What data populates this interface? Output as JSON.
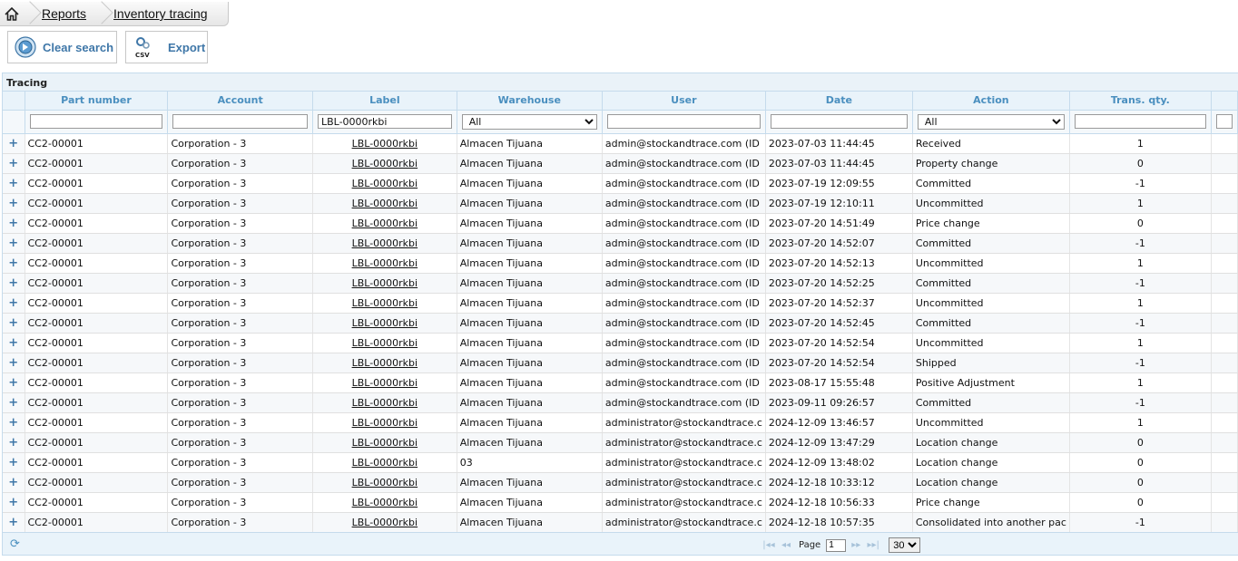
{
  "breadcrumb": {
    "items": [
      "Reports",
      "Inventory tracing"
    ]
  },
  "toolbar": {
    "clear_label": "Clear search",
    "export_label": "Export",
    "csv_text": "CSV"
  },
  "grid": {
    "caption": "Tracing",
    "columns": [
      "Part number",
      "Account",
      "Label",
      "Warehouse",
      "User",
      "Date",
      "Action",
      "Trans. qty."
    ],
    "filters": {
      "part": "",
      "account": "",
      "label": "LBL-0000rkbi",
      "warehouse": "All",
      "user": "",
      "date": "",
      "action": "All",
      "qty": ""
    },
    "rows": [
      [
        "CC2-00001",
        "Corporation - 3",
        "LBL-0000rkbi",
        "Almacen Tijuana",
        "admin@stockandtrace.com (ID",
        "2023-07-03 11:44:45",
        "Received",
        "1"
      ],
      [
        "CC2-00001",
        "Corporation - 3",
        "LBL-0000rkbi",
        "Almacen Tijuana",
        "admin@stockandtrace.com (ID",
        "2023-07-03 11:44:45",
        "Property change",
        "0"
      ],
      [
        "CC2-00001",
        "Corporation - 3",
        "LBL-0000rkbi",
        "Almacen Tijuana",
        "admin@stockandtrace.com (ID",
        "2023-07-19 12:09:55",
        "Committed",
        "-1"
      ],
      [
        "CC2-00001",
        "Corporation - 3",
        "LBL-0000rkbi",
        "Almacen Tijuana",
        "admin@stockandtrace.com (ID",
        "2023-07-19 12:10:11",
        "Uncommitted",
        "1"
      ],
      [
        "CC2-00001",
        "Corporation - 3",
        "LBL-0000rkbi",
        "Almacen Tijuana",
        "admin@stockandtrace.com (ID",
        "2023-07-20 14:51:49",
        "Price change",
        "0"
      ],
      [
        "CC2-00001",
        "Corporation - 3",
        "LBL-0000rkbi",
        "Almacen Tijuana",
        "admin@stockandtrace.com (ID",
        "2023-07-20 14:52:07",
        "Committed",
        "-1"
      ],
      [
        "CC2-00001",
        "Corporation - 3",
        "LBL-0000rkbi",
        "Almacen Tijuana",
        "admin@stockandtrace.com (ID",
        "2023-07-20 14:52:13",
        "Uncommitted",
        "1"
      ],
      [
        "CC2-00001",
        "Corporation - 3",
        "LBL-0000rkbi",
        "Almacen Tijuana",
        "admin@stockandtrace.com (ID",
        "2023-07-20 14:52:25",
        "Committed",
        "-1"
      ],
      [
        "CC2-00001",
        "Corporation - 3",
        "LBL-0000rkbi",
        "Almacen Tijuana",
        "admin@stockandtrace.com (ID",
        "2023-07-20 14:52:37",
        "Uncommitted",
        "1"
      ],
      [
        "CC2-00001",
        "Corporation - 3",
        "LBL-0000rkbi",
        "Almacen Tijuana",
        "admin@stockandtrace.com (ID",
        "2023-07-20 14:52:45",
        "Committed",
        "-1"
      ],
      [
        "CC2-00001",
        "Corporation - 3",
        "LBL-0000rkbi",
        "Almacen Tijuana",
        "admin@stockandtrace.com (ID",
        "2023-07-20 14:52:54",
        "Uncommitted",
        "1"
      ],
      [
        "CC2-00001",
        "Corporation - 3",
        "LBL-0000rkbi",
        "Almacen Tijuana",
        "admin@stockandtrace.com (ID",
        "2023-07-20 14:52:54",
        "Shipped",
        "-1"
      ],
      [
        "CC2-00001",
        "Corporation - 3",
        "LBL-0000rkbi",
        "Almacen Tijuana",
        "admin@stockandtrace.com (ID",
        "2023-08-17 15:55:48",
        "Positive Adjustment",
        "1"
      ],
      [
        "CC2-00001",
        "Corporation - 3",
        "LBL-0000rkbi",
        "Almacen Tijuana",
        "admin@stockandtrace.com (ID",
        "2023-09-11 09:26:57",
        "Committed",
        "-1"
      ],
      [
        "CC2-00001",
        "Corporation - 3",
        "LBL-0000rkbi",
        "Almacen Tijuana",
        "administrator@stockandtrace.c",
        "2024-12-09 13:46:57",
        "Uncommitted",
        "1"
      ],
      [
        "CC2-00001",
        "Corporation - 3",
        "LBL-0000rkbi",
        "Almacen Tijuana",
        "administrator@stockandtrace.c",
        "2024-12-09 13:47:29",
        "Location change",
        "0"
      ],
      [
        "CC2-00001",
        "Corporation - 3",
        "LBL-0000rkbi",
        "03",
        "administrator@stockandtrace.c",
        "2024-12-09 13:48:02",
        "Location change",
        "0"
      ],
      [
        "CC2-00001",
        "Corporation - 3",
        "LBL-0000rkbi",
        "Almacen Tijuana",
        "administrator@stockandtrace.c",
        "2024-12-18 10:33:12",
        "Location change",
        "0"
      ],
      [
        "CC2-00001",
        "Corporation - 3",
        "LBL-0000rkbi",
        "Almacen Tijuana",
        "administrator@stockandtrace.c",
        "2024-12-18 10:56:33",
        "Price change",
        "0"
      ],
      [
        "CC2-00001",
        "Corporation - 3",
        "LBL-0000rkbi",
        "Almacen Tijuana",
        "administrator@stockandtrace.c",
        "2024-12-18 10:57:35",
        "Consolidated into another pac",
        "-1"
      ]
    ],
    "expand_symbol": "+"
  },
  "pager": {
    "page_label": "Page",
    "page_value": "1",
    "page_size": "30"
  },
  "colors": {
    "accent": "#3f77a8",
    "header_text": "#4a8fbf",
    "header_bg": "#e9f3fa",
    "border": "#c5dbec"
  }
}
